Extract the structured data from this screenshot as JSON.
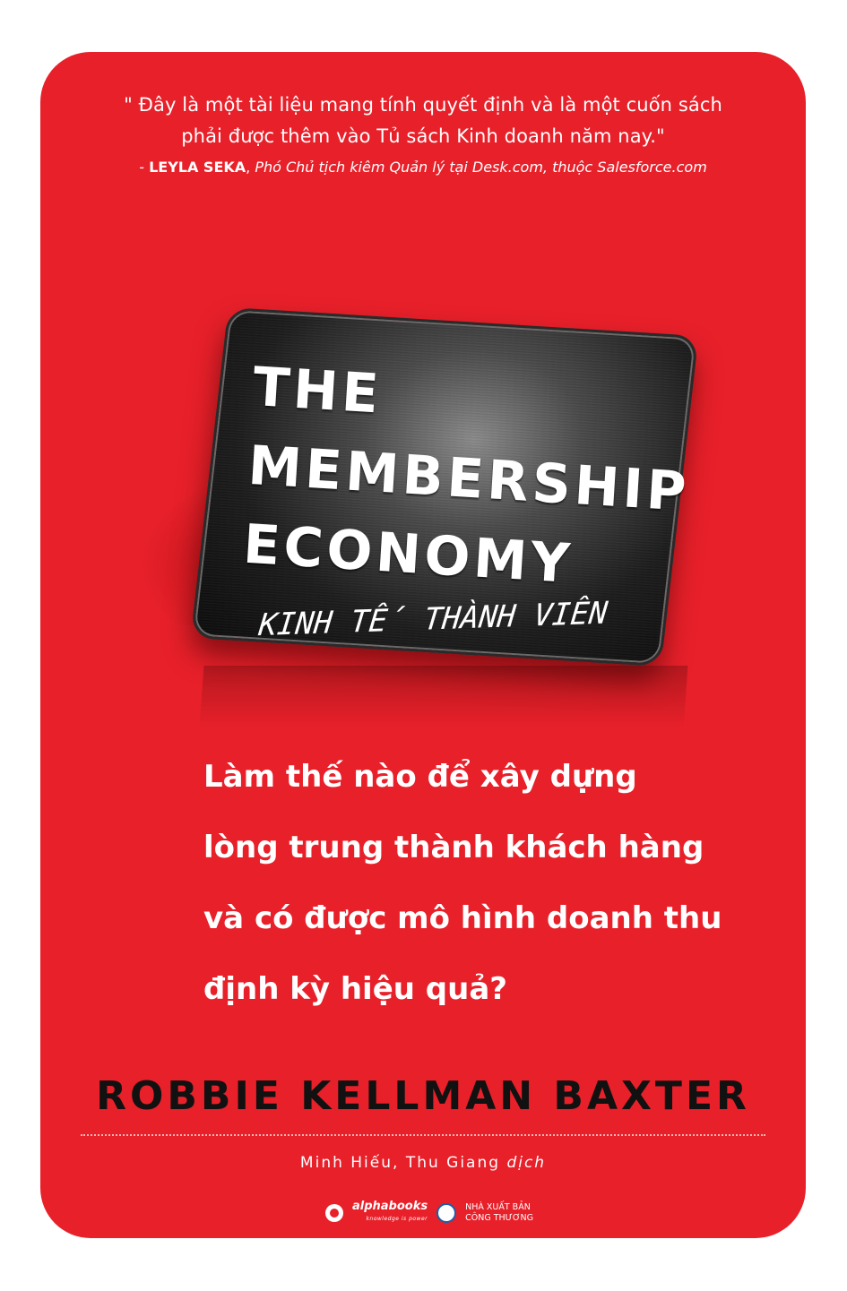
{
  "quote": {
    "line1": "\" Đây là một tài liệu mang tính quyết định và là một cuốn sách",
    "line2": "phải được thêm vào Tủ sách Kinh doanh năm nay.\"",
    "attr_prefix": "- ",
    "attr_name": "LEYLA SEKA",
    "attr_sep": ", ",
    "attr_role": "Phó Chủ tịch kiêm Quản lý tại Desk.com, thuộc Salesforce.com"
  },
  "card": {
    "title_lines": [
      "THE",
      "MEMBERSHIP",
      "ECONOMY"
    ],
    "subtitle": "KINH TẾ THÀNH VIÊN"
  },
  "question_lines": [
    "Làm thế nào để xây dựng",
    "lòng trung thành khách hàng",
    "và có được mô hình doanh thu",
    "định kỳ hiệu quả?"
  ],
  "author": "ROBBIE KELLMAN BAXTER",
  "translator": {
    "names": "Minh Hiếu, Thu Giang ",
    "role": "dịch"
  },
  "publishers": {
    "alpha": "alphabooks",
    "alpha_tagline": "knowledge is power",
    "nxb_line1": "NHÀ XUẤT BẢN",
    "nxb_line2": "CÔNG THƯƠNG"
  },
  "colors": {
    "cover_red": "#e8202a",
    "author_text": "#111111"
  }
}
